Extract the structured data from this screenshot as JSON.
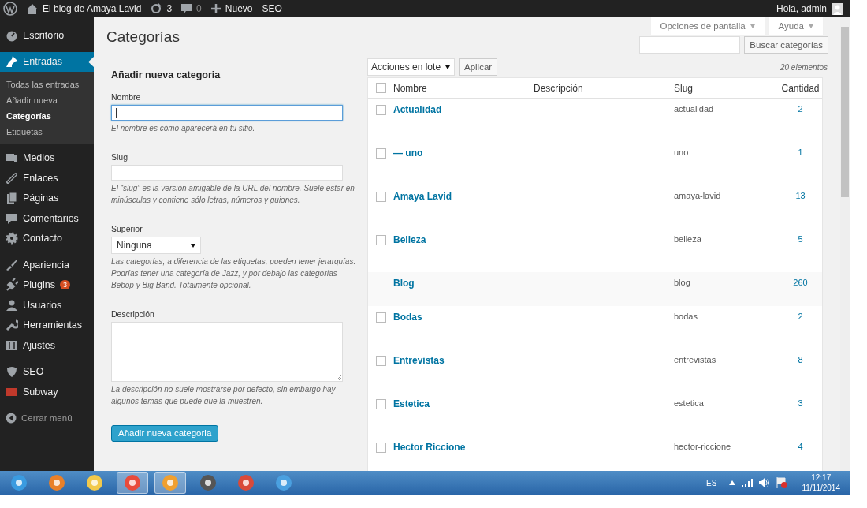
{
  "admin_bar": {
    "site": "El blog de Amaya Lavid",
    "updates": "3",
    "comments": "0",
    "new": "Nuevo",
    "seo": "SEO",
    "greeting": "Hola, admin"
  },
  "sidebar": {
    "groups": [
      {
        "items": [
          {
            "label": "Escritorio",
            "selected": false
          },
          {
            "label": "Entradas",
            "selected": true,
            "children": [
              {
                "label": "Todas las entradas",
                "selected": false
              },
              {
                "label": "Añadir nueva",
                "selected": false
              },
              {
                "label": "Categorías",
                "selected": true
              },
              {
                "label": "Etiquetas",
                "selected": false
              }
            ]
          },
          {
            "label": "Medios",
            "selected": false
          },
          {
            "label": "Enlaces",
            "selected": false
          },
          {
            "label": "Páginas",
            "selected": false
          },
          {
            "label": "Comentarios",
            "selected": false
          },
          {
            "label": "Contacto",
            "selected": false
          }
        ]
      },
      {
        "items": [
          {
            "label": "Apariencia",
            "selected": false
          },
          {
            "label": "Plugins",
            "selected": false,
            "badge": "3"
          },
          {
            "label": "Usuarios",
            "selected": false
          },
          {
            "label": "Herramientas",
            "selected": false
          },
          {
            "label": "Ajustes",
            "selected": false
          }
        ]
      },
      {
        "items": [
          {
            "label": "SEO",
            "selected": false
          },
          {
            "label": "Subway",
            "selected": false
          }
        ]
      }
    ],
    "collapse": "Cerrar menú"
  },
  "screen_tabs": [
    "Opciones de pantalla",
    "Ayuda"
  ],
  "page_title": "Categorías",
  "form": {
    "heading": "Añadir nueva categoria",
    "fields": [
      {
        "kind": "text",
        "label": "Nombre",
        "focused": true,
        "help": "El nombre es cómo aparecerá en tu sitio."
      },
      {
        "kind": "text",
        "label": "Slug",
        "focused": false,
        "help": "El “slug” es la versión amigable de la URL del nombre. Suele estar en minúsculas y contiene sólo letras, números y guiones."
      },
      {
        "kind": "select",
        "label": "Superior",
        "value": "Ninguna",
        "help": "Las categorías, a diferencia de las etiquetas, pueden tener jerarquías. Podrías tener una categoría de Jazz, y por debajo las categorías Bebop y Big Band. Totalmente opcional."
      },
      {
        "kind": "textarea",
        "label": "Descripción",
        "help": "La descripción no suele mostrarse por defecto, sin embargo hay algunos temas que puede que la muestren."
      }
    ],
    "submit": "Añadir nueva categoria"
  },
  "search": {
    "button": "Buscar categorías"
  },
  "bulk": {
    "select": "Acciones en lote",
    "apply": "Aplicar",
    "count": "20 elementos"
  },
  "table": {
    "select_all_checked": false,
    "columns": [
      "Nombre",
      "Descripción",
      "Slug",
      "Cantidad"
    ],
    "rows": [
      {
        "kind": "normal",
        "name": "Actualidad",
        "slug": "actualidad",
        "count": "2",
        "checked": false
      },
      {
        "kind": "normal",
        "name": "— uno",
        "slug": "uno",
        "count": "1",
        "checked": false
      },
      {
        "kind": "normal",
        "name": "Amaya Lavid",
        "slug": "amaya-lavid",
        "count": "13",
        "checked": false
      },
      {
        "kind": "normal",
        "name": "Belleza",
        "slug": "belleza",
        "count": "5",
        "checked": false
      },
      {
        "kind": "default",
        "name": "Blog",
        "slug": "blog",
        "count": "260"
      },
      {
        "kind": "normal",
        "name": "Bodas",
        "slug": "bodas",
        "count": "2",
        "checked": false
      },
      {
        "kind": "normal",
        "name": "Entrevistas",
        "slug": "entrevistas",
        "count": "8",
        "checked": false
      },
      {
        "kind": "normal",
        "name": "Estetica",
        "slug": "estetica",
        "count": "3",
        "checked": false
      },
      {
        "kind": "normal",
        "name": "Hector Riccione",
        "slug": "hector-riccione",
        "count": "4",
        "checked": false
      }
    ]
  },
  "taskbar": {
    "apps": [
      {
        "selected": false
      },
      {
        "selected": false
      },
      {
        "selected": false
      },
      {
        "selected": true
      },
      {
        "selected": true
      },
      {
        "selected": false
      },
      {
        "selected": false
      },
      {
        "selected": false
      }
    ],
    "language": "ES",
    "time": "12:17",
    "date": "11/11/2014"
  }
}
